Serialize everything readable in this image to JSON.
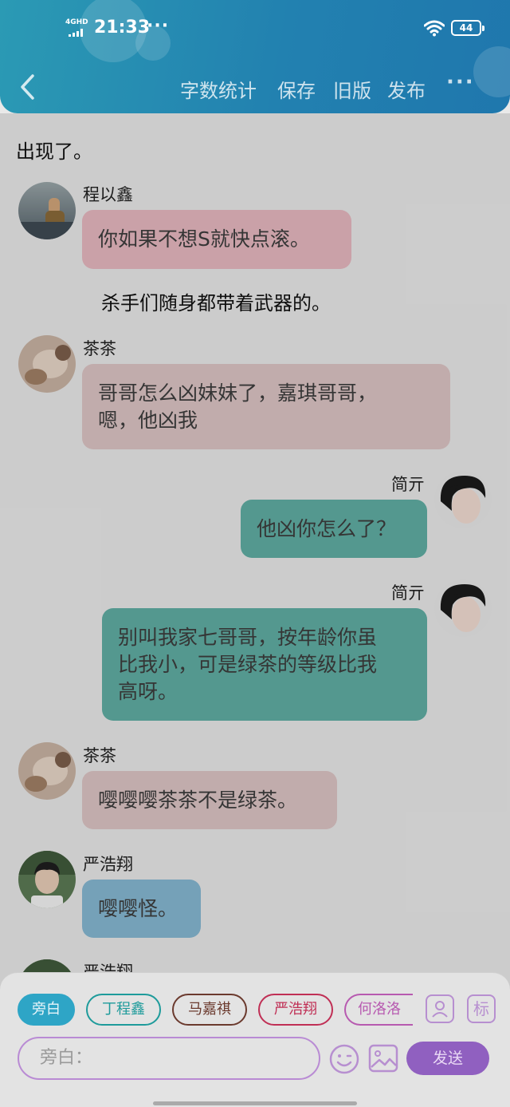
{
  "status_bar": {
    "network": "4GHD",
    "time": "21:33",
    "dots": "···",
    "battery": "44"
  },
  "toolbar": {
    "word_count": "字数统计",
    "save": "保存",
    "old_version": "旧版",
    "publish": "发布",
    "more": "···"
  },
  "messages": [
    {
      "type": "narration",
      "text": "出现了。"
    },
    {
      "type": "left",
      "name": "程以鑫",
      "lines": [
        "你如果不想S就快点滚。"
      ],
      "color": "#e6b8c0"
    },
    {
      "type": "narration",
      "text": "杀手们随身都带着武器的。"
    },
    {
      "type": "left",
      "name": "茶茶",
      "lines": [
        "哥哥怎么凶妹妹了，嘉琪哥哥，",
        "嗯，他凶我"
      ],
      "color": "#dcc4c4"
    },
    {
      "type": "right",
      "name": "简亓",
      "lines": [
        "他凶你怎么了？"
      ],
      "color": "#60ada3"
    },
    {
      "type": "right",
      "name": "简亓",
      "lines": [
        "别叫我家七哥哥，按年龄你虽",
        "比我小，可是绿茶的等级比我",
        "高呀。"
      ],
      "color": "#60ada3"
    },
    {
      "type": "left",
      "name": "茶茶",
      "lines": [
        "嘤嘤嘤茶茶不是绿茶。"
      ],
      "color": "#dcc4c4"
    },
    {
      "type": "left",
      "name": "严浩翔",
      "lines": [
        "嘤嘤怪。"
      ],
      "color": "#86b8d2"
    },
    {
      "type": "left",
      "name": "严浩翔",
      "lines": []
    }
  ],
  "roles": [
    {
      "label": "旁白",
      "color": "#2ea5c6",
      "filled": true
    },
    {
      "label": "丁程鑫",
      "color": "#1e9b9b",
      "filled": false
    },
    {
      "label": "马嘉祺",
      "color": "#6b3a2e",
      "filled": false
    },
    {
      "label": "严浩翔",
      "color": "#c02f55",
      "filled": false
    },
    {
      "label": "何洛洛",
      "color": "#b75ab0",
      "filled": false
    }
  ],
  "tag_button": "标",
  "input": {
    "placeholder": "旁白："
  },
  "send_label": "发送"
}
